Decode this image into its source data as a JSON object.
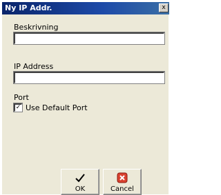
{
  "window": {
    "title": "Ny IP Addr."
  },
  "title_bar": {
    "close_glyph": "x",
    "close_icon": "close-icon"
  },
  "form": {
    "description_label": "Beskrivning",
    "description_value": "",
    "ip_label": "IP Address",
    "ip_value": "",
    "port_label": "Port",
    "use_default_port_label": "Use Default Port",
    "use_default_port_checked": true
  },
  "buttons": {
    "ok_label": "OK",
    "ok_icon": "checkmark-icon",
    "cancel_label": "Cancel",
    "cancel_icon": "cancel-x-icon",
    "cancel_color": "#d9412f"
  }
}
